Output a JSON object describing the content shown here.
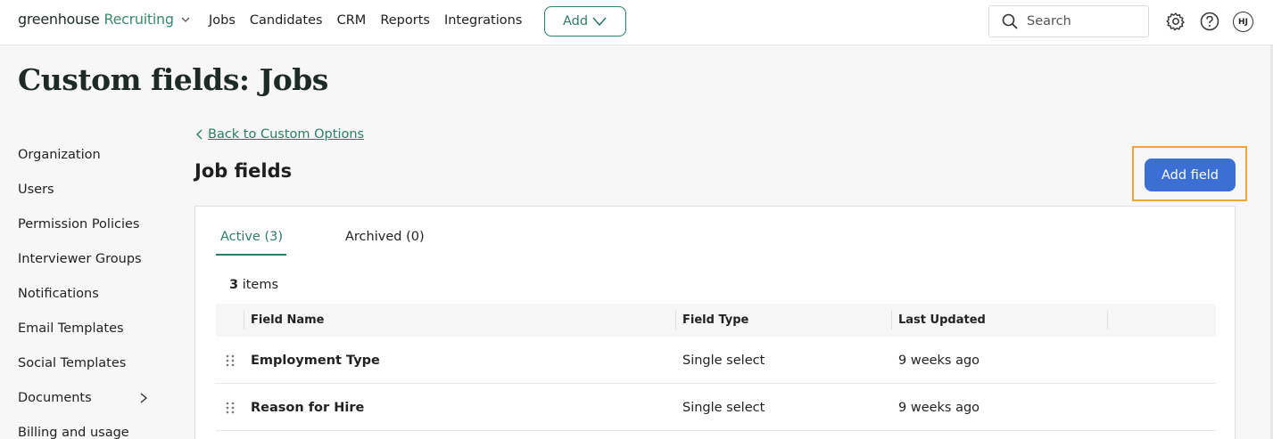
{
  "nav": {
    "brand_main": "greenhouse",
    "brand_product": "Recruiting",
    "links": [
      "Jobs",
      "Candidates",
      "CRM",
      "Reports",
      "Integrations"
    ],
    "add_label": "Add",
    "search_placeholder": "Search",
    "avatar_initials": "HJ"
  },
  "page": {
    "title": "Custom fields: Jobs"
  },
  "sidebar": {
    "items": [
      {
        "label": "Organization"
      },
      {
        "label": "Users"
      },
      {
        "label": "Permission Policies"
      },
      {
        "label": "Interviewer Groups"
      },
      {
        "label": "Notifications"
      },
      {
        "label": "Email Templates"
      },
      {
        "label": "Social Templates"
      },
      {
        "label": "Documents"
      },
      {
        "label": "Billing and usage"
      }
    ]
  },
  "main": {
    "back_label": "Back to Custom Options",
    "section_title": "Job fields",
    "add_field_label": "Add field",
    "tabs": [
      {
        "label": "Active (3)",
        "active": true
      },
      {
        "label": "Archived (0)",
        "active": false
      }
    ],
    "count_number": "3",
    "count_suffix": "items",
    "columns": [
      "Field Name",
      "Field Type",
      "Last Updated"
    ],
    "rows": [
      {
        "name": "Employment Type",
        "type": "Single select",
        "updated": "9 weeks ago"
      },
      {
        "name": "Reason for Hire",
        "type": "Single select",
        "updated": "9 weeks ago"
      }
    ]
  },
  "colors": {
    "brand_green": "#2d7d5f",
    "primary_blue": "#3b6fd4",
    "highlight_orange": "#f2a43a"
  }
}
